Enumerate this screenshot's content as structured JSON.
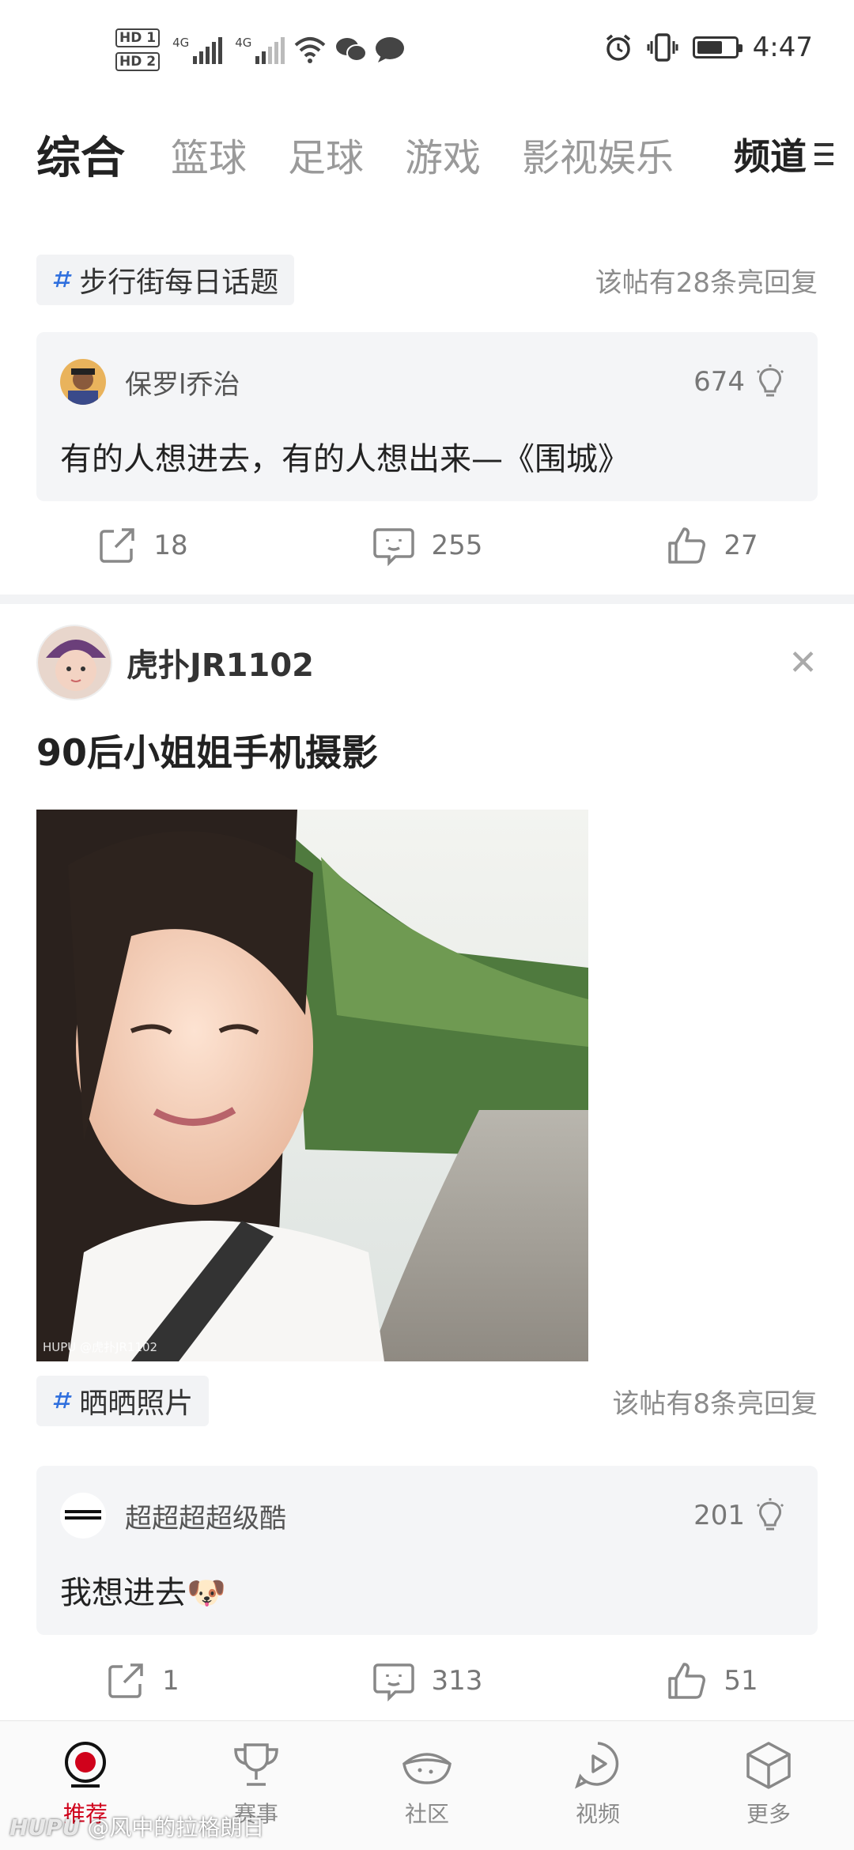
{
  "status_bar": {
    "hd1": "HD 1",
    "hd2": "HD 2",
    "net1": "4G",
    "net2": "4G",
    "time": "4:47",
    "icons": [
      "signal-icon",
      "wifi-icon",
      "wechat-icon",
      "message-icon",
      "alarm-icon",
      "vibrate-icon",
      "battery-icon"
    ]
  },
  "tabs": {
    "items": [
      "综合",
      "篮球",
      "足球",
      "游戏",
      "影视娱乐"
    ],
    "active": "综合",
    "channel_label": "频道"
  },
  "post1": {
    "topic": "步行街每日话题",
    "reply_count": "该帖有28条亮回复",
    "hot_reply": {
      "user": "保罗l乔治",
      "likes": "674",
      "text": "有的人想进去，有的人想出来—《围城》"
    },
    "actions": {
      "share": "18",
      "comment": "255",
      "like": "27"
    }
  },
  "post2": {
    "author": "虎扑JR1102",
    "title": "90后小姐姐手机摄影",
    "image_watermark": "HUPU @虎扑JR1102",
    "topic": "晒晒照片",
    "reply_count": "该帖有8条亮回复",
    "hot_reply": {
      "user": "超超超超级酷",
      "likes": "201",
      "text": "我想进去🐶"
    },
    "actions": {
      "share": "1",
      "comment": "313",
      "like": "51"
    }
  },
  "bottom_nav": {
    "items": [
      {
        "label": "推荐",
        "icon": "recommend-icon"
      },
      {
        "label": "赛事",
        "icon": "trophy-icon"
      },
      {
        "label": "社区",
        "icon": "community-icon"
      },
      {
        "label": "视频",
        "icon": "video-icon"
      },
      {
        "label": "更多",
        "icon": "cube-icon"
      }
    ]
  },
  "screen_watermark": {
    "brand": "HUPU",
    "text": "@风中的拉格朗日"
  },
  "colors": {
    "accent": "#d0021b",
    "topic_blue": "#2f6fde",
    "tag_bg": "#f2f3f5"
  }
}
